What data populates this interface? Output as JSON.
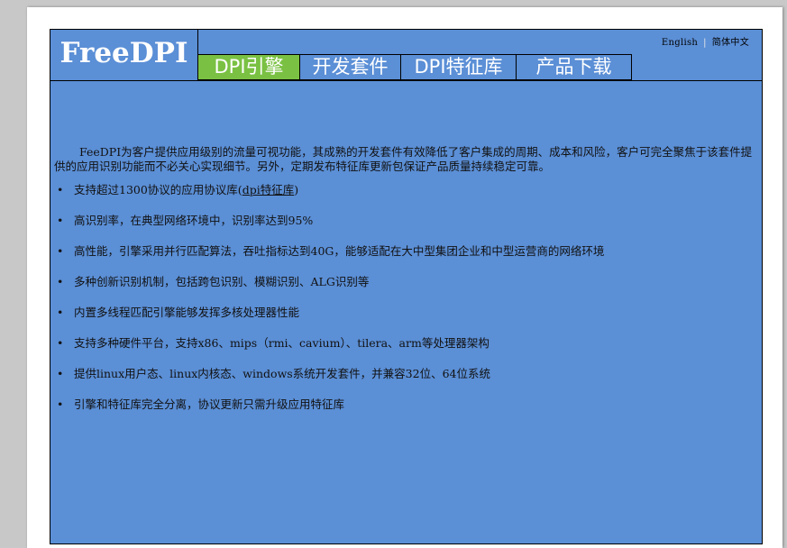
{
  "brand": {
    "logo": "FreeDPI"
  },
  "lang": {
    "english": "English",
    "separator": "|",
    "chinese": "简体中文"
  },
  "nav": [
    {
      "label": "DPI引擎",
      "active": true
    },
    {
      "label": "开发套件",
      "active": false
    },
    {
      "label": "DPI特征库",
      "active": false
    },
    {
      "label": "产品下载",
      "active": false
    }
  ],
  "content": {
    "intro": "FeeDPI为客户提供应用级别的流量可视功能，其成熟的开发套件有效降低了客户集成的周期、成本和风险，客户可完全聚焦于该套件提供的应用识别功能而不必关心实现细节。另外，定期发布特征库更新包保证产品质量持续稳定可靠。",
    "bullet": "•",
    "feature0_prefix": "支持超过1300协议的应用协议库(",
    "feature0_link": "dpi特征库",
    "feature0_suffix": ")",
    "features": [
      "高识别率，在典型网络环境中，识别率达到95%",
      "高性能，引擎采用并行匹配算法，吞吐指标达到40G，能够适配在大中型集团企业和中型运营商的网络环境",
      "多种创新识别机制，包括跨包识别、模糊识别、ALG识别等",
      "内置多线程匹配引擎能够发挥多核处理器性能",
      "支持多种硬件平台，支持x86、mips（rmi、cavium）、tilera、arm等处理器架构",
      "提供linux用户态、linux内核态、windows系统开发套件，并兼容32位、64位系统",
      "引擎和特征库完全分离，协议更新只需升级应用特征库"
    ]
  },
  "colors": {
    "content_bg": "#5b8fd6",
    "active_tab": "#7ac143",
    "page_bg": "#ffffff",
    "outer_bg": "#c8c8c8"
  }
}
